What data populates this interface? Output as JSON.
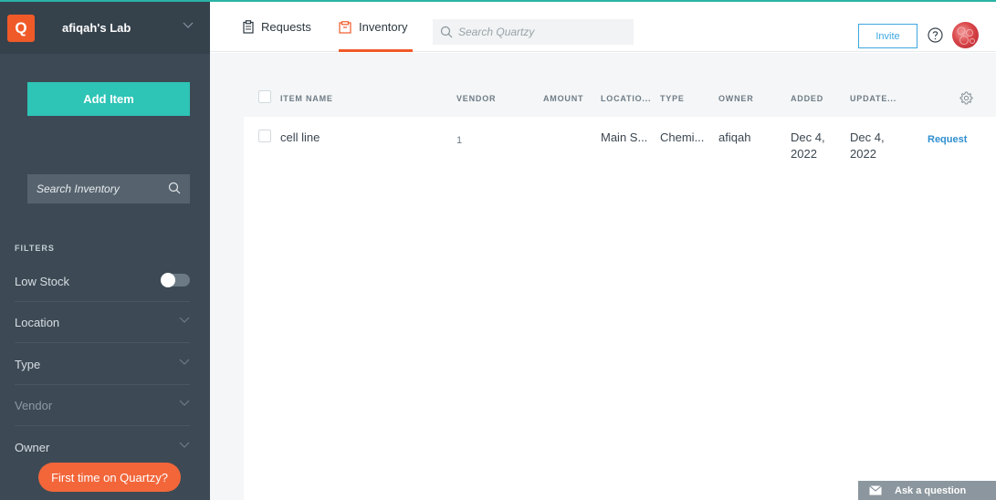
{
  "sidebar": {
    "logo_letter": "Q",
    "lab_name": "afiqah's Lab",
    "add_item_label": "Add Item",
    "search_placeholder": "Search Inventory",
    "filters_label": "FILTERS",
    "filters": [
      {
        "label": "Low Stock",
        "kind": "toggle",
        "on": false
      },
      {
        "label": "Location",
        "kind": "dropdown"
      },
      {
        "label": "Type",
        "kind": "dropdown"
      },
      {
        "label": "Vendor",
        "kind": "dropdown"
      },
      {
        "label": "Owner",
        "kind": "dropdown"
      }
    ],
    "first_time_label": "First time on Quartzy?"
  },
  "topbar": {
    "tabs": [
      {
        "label": "Requests",
        "icon": "clipboard-icon",
        "active": false
      },
      {
        "label": "Inventory",
        "icon": "box-icon",
        "active": true
      }
    ],
    "search_placeholder": "Search Quartzy",
    "invite_label": "Invite"
  },
  "table": {
    "columns": [
      "ITEM NAME",
      "VENDOR",
      "AMOUNT",
      "LOCATIO...",
      "TYPE",
      "OWNER",
      "ADDED",
      "UPDATE..."
    ],
    "rows": [
      {
        "item_name": "cell line",
        "vendor": "1",
        "amount": "",
        "location": "Main S...",
        "type": "Chemi...",
        "owner": "afiqah",
        "added_1": "Dec 4,",
        "added_2": "2022",
        "updated_1": "Dec 4,",
        "updated_2": "2022",
        "action": "Request"
      }
    ]
  },
  "ask_label": "Ask a question",
  "colors": {
    "brand_orange": "#f05a28",
    "teal": "#2ec4b6",
    "sidebar_bg": "#3d4a55",
    "link_blue": "#2f8fd0"
  }
}
